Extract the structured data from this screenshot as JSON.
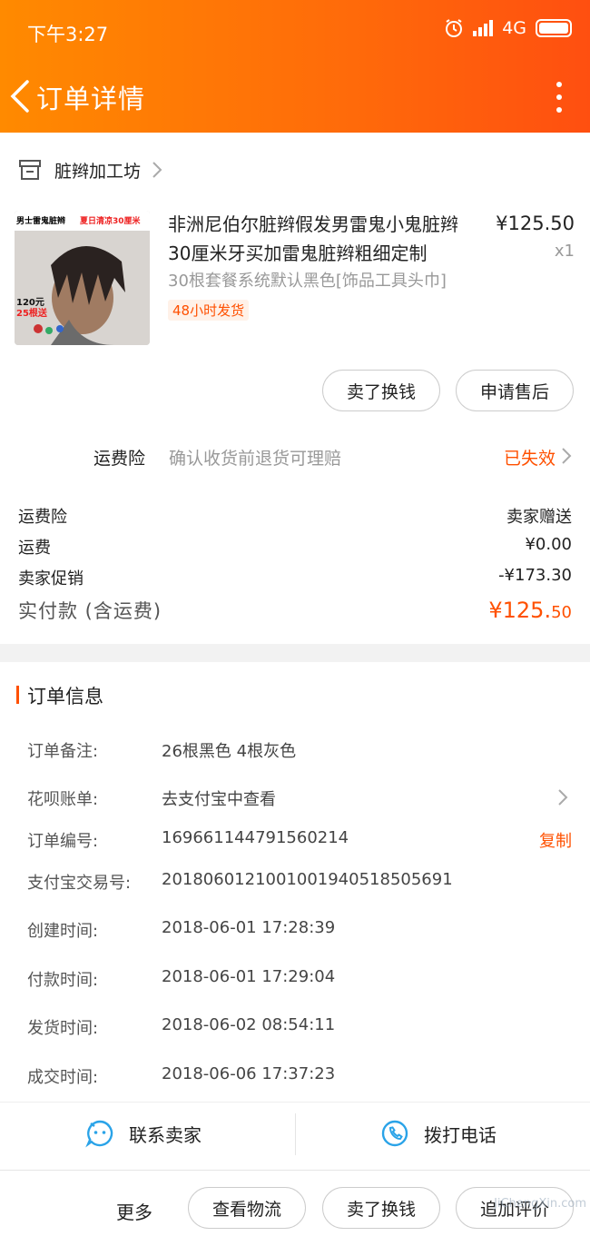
{
  "status_bar": {
    "time": "下午3:27",
    "network": "4G"
  },
  "header": {
    "title": "订单详情"
  },
  "shop": {
    "name": "脏辫加工坊"
  },
  "product": {
    "title": "非洲尼伯尔脏辫假发男雷鬼小鬼脏辫30厘米牙买加雷鬼脏辫粗细定制",
    "price": "¥125.50",
    "qty": "x1",
    "sku": "30根套餐系统默认黑色[饰品工具头巾]",
    "tag": "48小时发货",
    "thumb_text": {
      "top_left": "男士雷鬼脏辫",
      "top_right": "夏日清凉30厘米",
      "price": "120元",
      "count": "25根送"
    }
  },
  "product_actions": {
    "resell": "卖了换钱",
    "after_sale": "申请售后"
  },
  "insurance": {
    "label": "运费险",
    "desc": "确认收货前退货可理赔",
    "status": "已失效"
  },
  "fees": [
    {
      "label": "运费险",
      "value": "卖家赠送"
    },
    {
      "label": "运费",
      "value": "¥0.00"
    },
    {
      "label": "卖家促销",
      "value": "-¥173.30"
    }
  ],
  "total": {
    "label": "实付款 (含运费)",
    "main": "¥125.",
    "cents": "50"
  },
  "order_info": {
    "title": "订单信息",
    "rows": [
      {
        "label": "订单备注:",
        "value": "26根黑色 4根灰色"
      },
      {
        "label": "花呗账单:",
        "value": "去支付宝中查看"
      },
      {
        "label": "订单编号:",
        "value": "169661144791560214",
        "action": "复制"
      },
      {
        "label": "支付宝交易号:",
        "value": "2018060121001001940518505691"
      },
      {
        "label": "创建时间:",
        "value": "2018-06-01 17:28:39"
      },
      {
        "label": "付款时间:",
        "value": "2018-06-01 17:29:04"
      },
      {
        "label": "发货时间:",
        "value": "2018-06-02 08:54:11"
      },
      {
        "label": "成交时间:",
        "value": "2018-06-06 17:37:23"
      }
    ]
  },
  "contact": {
    "seller": "联系卖家",
    "call": "拨打电话"
  },
  "bottom_bar": {
    "more": "更多",
    "logistics": "查看物流",
    "resell": "卖了换钱",
    "review": "追加评价"
  },
  "watermark": "JiChengXin.com",
  "colors": {
    "accent": "#ff5000",
    "header_start": "#ff8a00",
    "header_end": "#ff4f10",
    "contact_icon": "#2aa3e8"
  }
}
